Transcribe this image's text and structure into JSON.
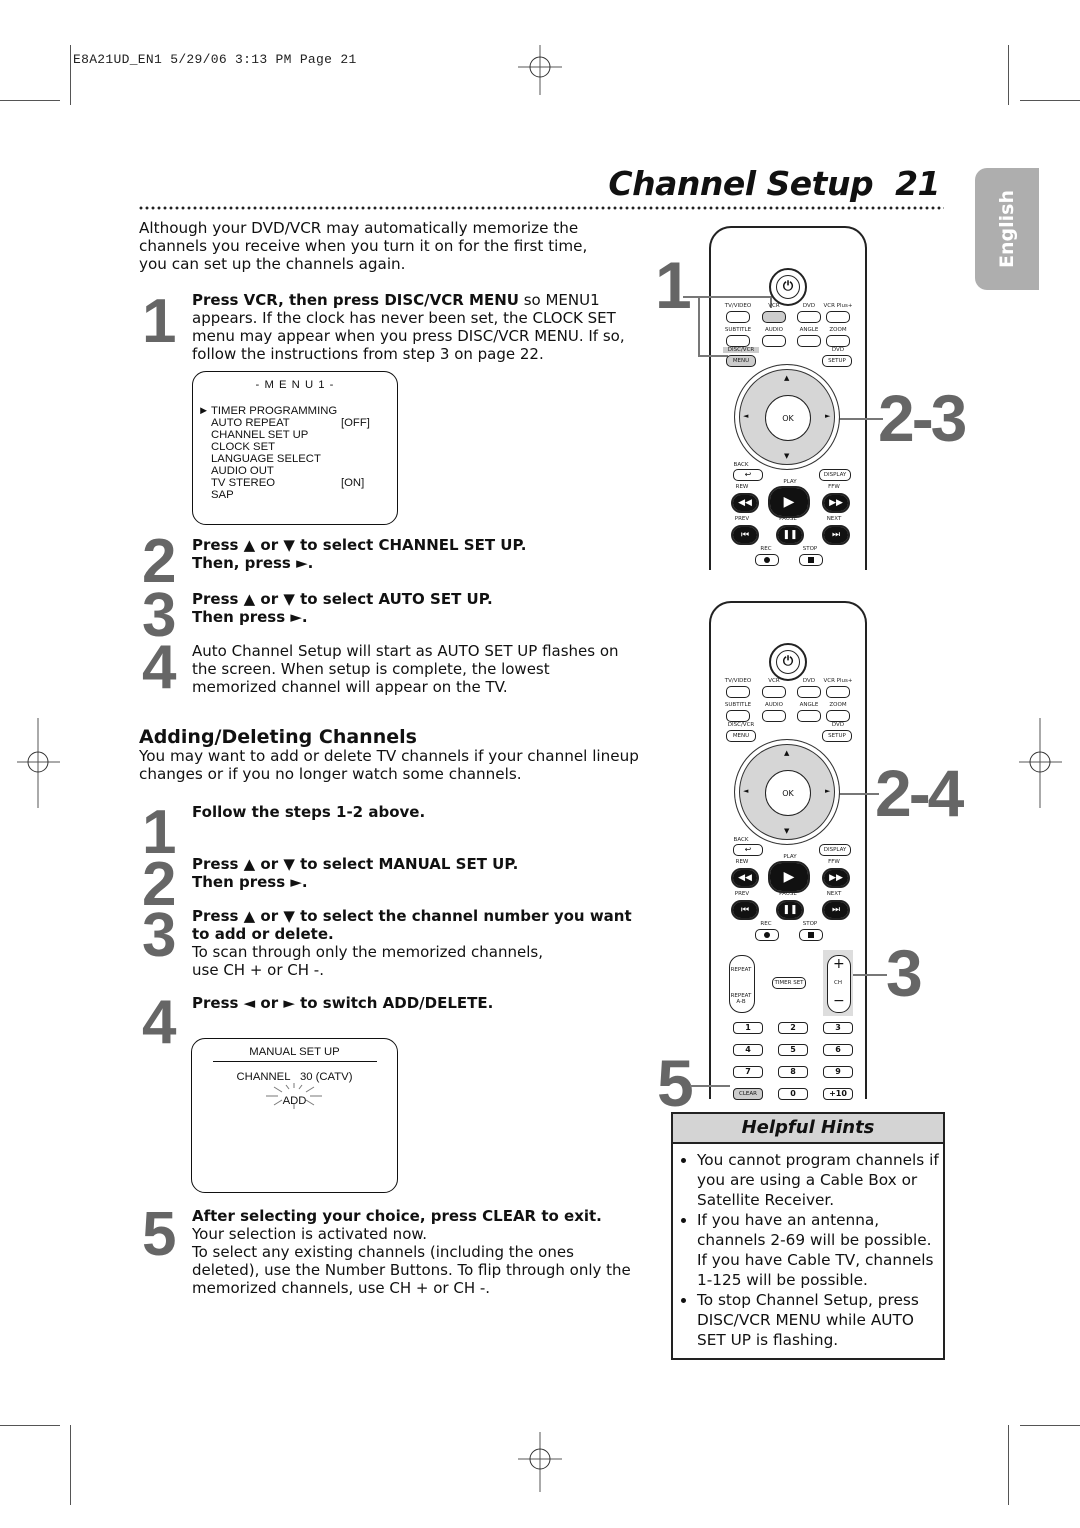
{
  "slug": "E8A21UD_EN1  5/29/06  3:13 PM  Page 21",
  "header": {
    "title": "Channel Setup",
    "page_number": "21"
  },
  "language_tab": "English",
  "intro": "Although your DVD/VCR may automatically memorize the channels you receive when you turn it on for the first time, you can set up the channels again.",
  "auto_setup": {
    "steps": [
      {
        "num": "1",
        "bold": "Press VCR, then press DISC/VCR MENU",
        "text": " so MENU1 appears. If the clock has never been set, the CLOCK SET menu may appear when you press DISC/VCR MENU. If so, follow the instructions from step 3 on page 22."
      },
      {
        "num": "2",
        "bold": "Press ▲ or ▼ to select CHANNEL SET UP. Then, press ►.",
        "text": ""
      },
      {
        "num": "3",
        "bold": "Press ▲ or ▼ to select AUTO SET UP. Then press ►.",
        "text": ""
      },
      {
        "num": "4",
        "bold": "",
        "text": "Auto Channel Setup will start as AUTO SET UP flashes on the screen. When setup is complete, the lowest memorized channel will appear on the TV."
      }
    ],
    "menu1": {
      "title": "- M E N U 1 -",
      "cursor": "►",
      "items": [
        {
          "label": "TIMER PROGRAMMING",
          "value": ""
        },
        {
          "label": "AUTO REPEAT",
          "value": "[OFF]"
        },
        {
          "label": "CHANNEL SET UP",
          "value": ""
        },
        {
          "label": "CLOCK SET",
          "value": ""
        },
        {
          "label": "LANGUAGE SELECT",
          "value": ""
        },
        {
          "label": "AUDIO OUT",
          "value": ""
        },
        {
          "label": "TV STEREO",
          "value": "[ON]"
        },
        {
          "label": "SAP",
          "value": ""
        }
      ]
    }
  },
  "adding": {
    "heading": "Adding/Deleting Channels",
    "intro": "You may want to add or delete TV channels if your channel lineup changes or if you no longer watch some channels.",
    "steps": [
      {
        "num": "1",
        "bold": "Follow the steps 1-2 above.",
        "text": ""
      },
      {
        "num": "2",
        "bold": "Press ▲ or ▼ to select MANUAL SET UP. Then press ►.",
        "text": ""
      },
      {
        "num": "3",
        "bold": "Press ▲ or ▼ to select the channel number you want to add or delete.",
        "text": "To scan through only the memorized channels, use CH + or CH -."
      },
      {
        "num": "4",
        "bold": "Press ◄ or ► to switch ADD/DELETE.",
        "text": ""
      },
      {
        "num": "5",
        "bold": "After selecting your choice, press CLEAR to exit.",
        "text": "Your selection is activated now.",
        "text2": "To select any existing channels (including the ones deleted), use the Number Buttons. To flip through only the memorized channels, use CH + or CH -."
      }
    ],
    "manual_screen": {
      "title": "MANUAL SET UP",
      "channel_label": "CHANNEL",
      "channel_value": "30 (CATV)",
      "status": "ADD"
    }
  },
  "remote": {
    "row1": [
      "TV/VIDEO",
      "VCR",
      "DVD",
      "VCR Plus+"
    ],
    "row2": [
      "SUBTITLE",
      "AUDIO",
      "ANGLE",
      "ZOOM"
    ],
    "menu_label_top": "DISC/VCR",
    "menu_label": "MENU",
    "setup_label_top": "DVD",
    "setup_label": "SETUP",
    "ok": "OK",
    "back": "BACK",
    "display": "DISPLAY",
    "rew": "REW",
    "play": "PLAY",
    "ffw": "FFW",
    "prev": "PREV",
    "pause": "PAUSE",
    "next": "NEXT",
    "rec": "REC",
    "stop": "STOP",
    "repeat": "REPEAT",
    "repeat_ab": "REPEAT A-B",
    "timer_set": "TIMER SET",
    "ch": "CH",
    "ch_plus": "+",
    "ch_minus": "−",
    "numbers": [
      "1",
      "2",
      "3",
      "4",
      "5",
      "6",
      "7",
      "8",
      "9",
      "CLEAR",
      "0",
      "+10"
    ]
  },
  "callouts": {
    "top_1": "1",
    "top_23": "2-3",
    "bottom_24": "2-4",
    "bottom_3": "3",
    "bottom_5": "5"
  },
  "hints": {
    "title": "Helpful Hints",
    "items": [
      "You cannot program channels if you are using a Cable Box or Satellite Receiver.",
      "If you have an antenna, channels 2-69 will be possible. If you have Cable TV, channels 1-125 will be possible.",
      "To stop Channel Setup, press DISC/VCR MENU while AUTO SET UP is flashing."
    ]
  }
}
